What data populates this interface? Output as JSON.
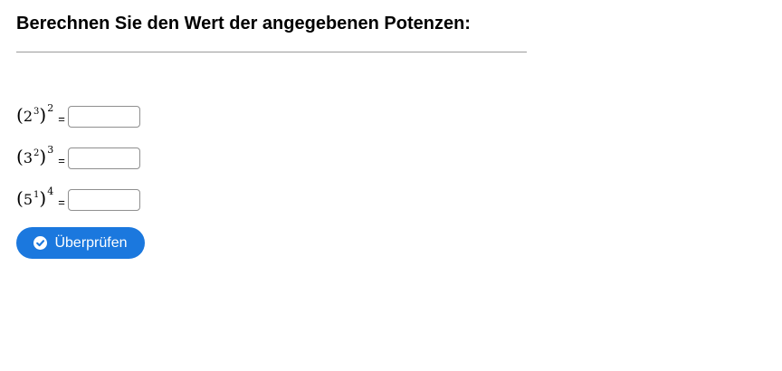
{
  "header": {
    "title": "Berechnen Sie den Wert der angegebenen Potenzen:"
  },
  "exercises": [
    {
      "open_paren": "(",
      "base": "2",
      "inner_exponent": "3",
      "close_paren": ")",
      "outer_exponent": "2",
      "equals": "=",
      "answer_value": ""
    },
    {
      "open_paren": "(",
      "base": "3",
      "inner_exponent": "2",
      "close_paren": ")",
      "outer_exponent": "3",
      "equals": "=",
      "answer_value": ""
    },
    {
      "open_paren": "(",
      "base": "5",
      "inner_exponent": "1",
      "close_paren": ")",
      "outer_exponent": "4",
      "equals": "=",
      "answer_value": ""
    }
  ],
  "check_button": {
    "label": "Überprüfen",
    "icon": "check-circle-icon",
    "color": "#1b78de"
  }
}
